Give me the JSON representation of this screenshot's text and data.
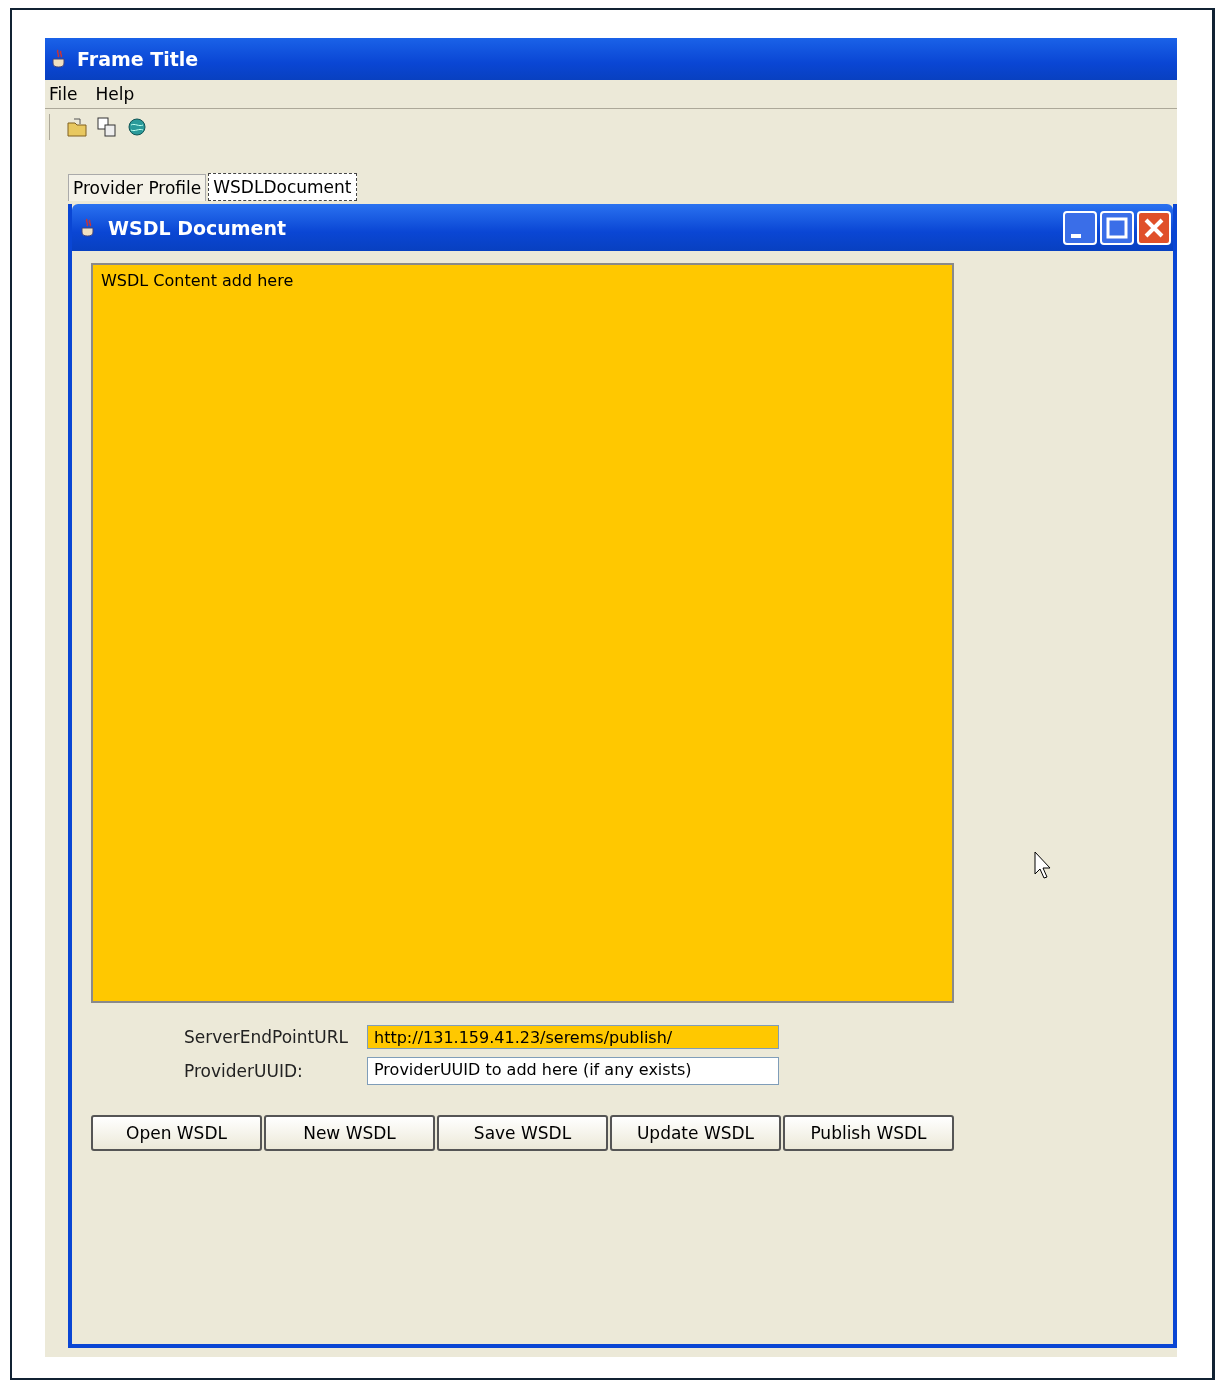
{
  "window": {
    "title": "Frame Title"
  },
  "menu": [
    "File",
    "Help"
  ],
  "tabs": [
    {
      "label": "Provider Profile",
      "selected": false
    },
    {
      "label": "WSDLDocument",
      "selected": true
    }
  ],
  "internal_frame": {
    "title": "WSDL Document"
  },
  "content": {
    "text": "WSDL Content add here",
    "highlighted": true
  },
  "fields": [
    {
      "label": "ServerEndPointURL",
      "value": "http://131.159.41.23/serems/publish/",
      "highlighted": true
    },
    {
      "label": "ProviderUUID:",
      "value": "ProviderUUID to add here (if any exists)",
      "highlighted": false
    }
  ],
  "buttons": [
    "Open WSDL",
    "New WSDL",
    "Save WSDL",
    "Update WSDL",
    "Publish WSDL"
  ]
}
